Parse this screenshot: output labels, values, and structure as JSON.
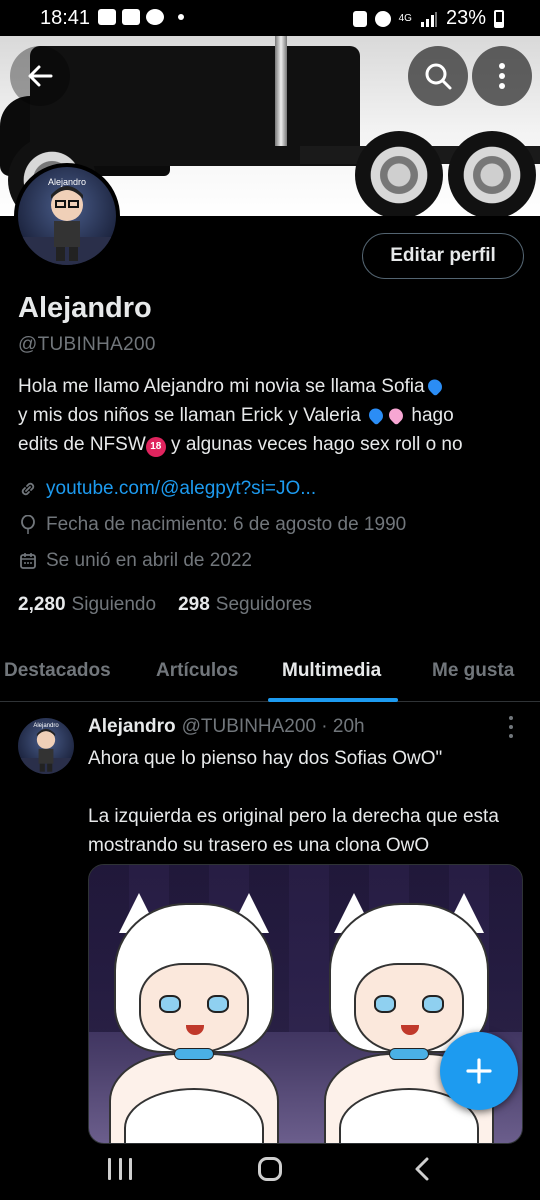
{
  "status_bar": {
    "time": "18:41",
    "network": "4G",
    "battery": "23%",
    "icons": [
      "video-icon",
      "video-icon",
      "discord-icon",
      "alarm-icon",
      "battery-saver-icon",
      "signal-icon",
      "battery-icon"
    ]
  },
  "profile": {
    "avatar_label": "Alejandro",
    "name": "Alejandro",
    "handle": "@TUBINHA200",
    "edit_label": "Editar perfil",
    "bio": {
      "line1_before": "Hola me llamo Alejandro mi novia se llama Sofia",
      "line2_before": "y mis dos niños se llaman Erick y Valeria ",
      "line2_after": " hago",
      "line3_before": "edits de NFSW",
      "line3_after": " y algunas veces hago sex roll o no",
      "badge_18": "18"
    },
    "link": "youtube.com/@alegpyt?si=JO...",
    "birthday": "Fecha de nacimiento: 6 de agosto de 1990",
    "joined": "Se unió en abril de 2022",
    "following_count": "2,280",
    "following_label": "Siguiendo",
    "followers_count": "298",
    "followers_label": "Seguidores"
  },
  "tabs": [
    {
      "label": "Destacados",
      "active": false
    },
    {
      "label": "Artículos",
      "active": false
    },
    {
      "label": "Multimedia",
      "active": true
    },
    {
      "label": "Me gusta",
      "active": false
    }
  ],
  "post": {
    "avatar_label": "Alejandro",
    "name": "Alejandro",
    "handle": "@TUBINHA200",
    "separator": "·",
    "time": "20h",
    "text": "Ahora que lo pienso hay dos Sofias OwO\"\n\nLa izquierda es original pero la derecha que esta mostrando su trasero es una clona OwO"
  },
  "colors": {
    "accent": "#1d9bf0",
    "background": "#000000",
    "text_primary": "#e7e9ea",
    "text_secondary": "#71767b"
  }
}
